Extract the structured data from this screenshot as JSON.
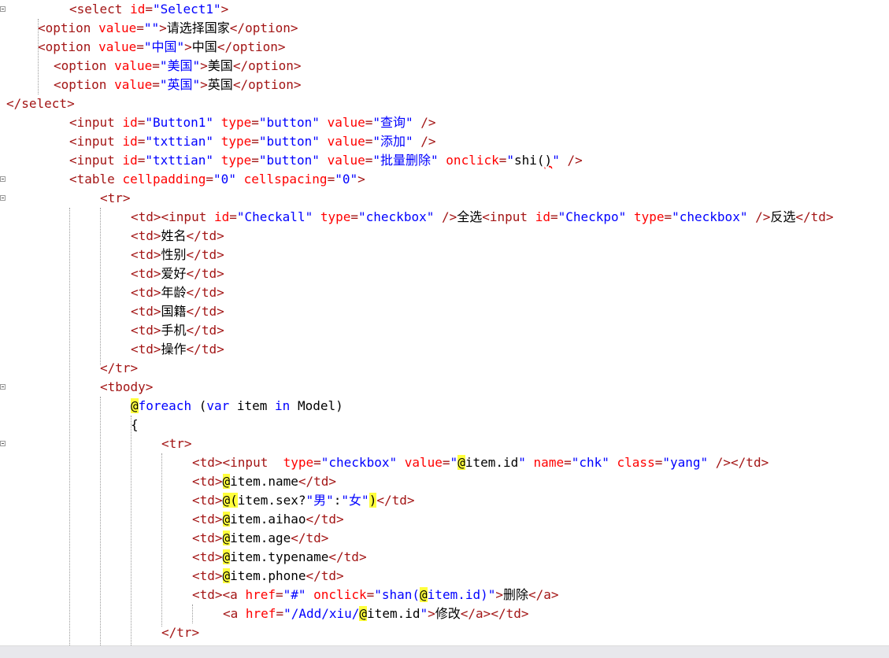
{
  "editor": {
    "lines": [
      {
        "indent": 88,
        "tokens": [
          [
            "tg",
            "<select "
          ],
          [
            "at",
            "id"
          ],
          [
            "tg",
            "="
          ],
          [
            "vl",
            "\"Select1\""
          ],
          [
            "tg",
            ">"
          ]
        ]
      },
      {
        "indent": 48,
        "tokens": [
          [
            "tg",
            "<option "
          ],
          [
            "at",
            "value"
          ],
          [
            "tg",
            "="
          ],
          [
            "vl",
            "\"\""
          ],
          [
            "tg",
            ">"
          ],
          [
            "tx",
            "请选择国家"
          ],
          [
            "tg",
            "</option>"
          ]
        ]
      },
      {
        "indent": 48,
        "tokens": [
          [
            "tg",
            "<option "
          ],
          [
            "at",
            "value"
          ],
          [
            "tg",
            "="
          ],
          [
            "vl",
            "\"中国\""
          ],
          [
            "tg",
            ">"
          ],
          [
            "tx",
            "中国"
          ],
          [
            "tg",
            "</option>"
          ]
        ]
      },
      {
        "indent": 68,
        "tokens": [
          [
            "tg",
            "<option "
          ],
          [
            "at",
            "value"
          ],
          [
            "tg",
            "="
          ],
          [
            "vl",
            "\"美国\""
          ],
          [
            "tg",
            ">"
          ],
          [
            "tx",
            "美国"
          ],
          [
            "tg",
            "</option>"
          ]
        ]
      },
      {
        "indent": 68,
        "tokens": [
          [
            "tg",
            "<option "
          ],
          [
            "at",
            "value"
          ],
          [
            "tg",
            "="
          ],
          [
            "vl",
            "\"英国\""
          ],
          [
            "tg",
            ">"
          ],
          [
            "tx",
            "英国"
          ],
          [
            "tg",
            "</option>"
          ]
        ]
      },
      {
        "indent": 8,
        "tokens": [
          [
            "tg",
            "</select>"
          ]
        ]
      },
      {
        "indent": 88,
        "tokens": [
          [
            "tg",
            "<input "
          ],
          [
            "at",
            "id"
          ],
          [
            "tg",
            "="
          ],
          [
            "vl",
            "\"Button1\""
          ],
          [
            "tg",
            " "
          ],
          [
            "at",
            "type"
          ],
          [
            "tg",
            "="
          ],
          [
            "vl",
            "\"button\""
          ],
          [
            "tg",
            " "
          ],
          [
            "at",
            "value"
          ],
          [
            "tg",
            "="
          ],
          [
            "vl",
            "\"查询\""
          ],
          [
            "tg",
            " />"
          ]
        ]
      },
      {
        "indent": 88,
        "tokens": [
          [
            "tg",
            "<input "
          ],
          [
            "at",
            "id"
          ],
          [
            "tg",
            "="
          ],
          [
            "vl",
            "\"txttian\""
          ],
          [
            "tg",
            " "
          ],
          [
            "at",
            "type"
          ],
          [
            "tg",
            "="
          ],
          [
            "vl",
            "\"button\""
          ],
          [
            "tg",
            " "
          ],
          [
            "at",
            "value"
          ],
          [
            "tg",
            "="
          ],
          [
            "vl",
            "\"添加\""
          ],
          [
            "tg",
            " />"
          ]
        ]
      },
      {
        "indent": 88,
        "tokens": [
          [
            "tg",
            "<input "
          ],
          [
            "at",
            "id"
          ],
          [
            "tg",
            "="
          ],
          [
            "vl",
            "\"txttian\""
          ],
          [
            "tg",
            " "
          ],
          [
            "at",
            "type"
          ],
          [
            "tg",
            "="
          ],
          [
            "vl",
            "\"button\""
          ],
          [
            "tg",
            " "
          ],
          [
            "at",
            "value"
          ],
          [
            "tg",
            "="
          ],
          [
            "vl",
            "\"批量删除\""
          ],
          [
            "tg",
            " "
          ],
          [
            "at",
            "onclick"
          ],
          [
            "tg",
            "="
          ],
          [
            "vl",
            "\""
          ],
          [
            "tx",
            "shi("
          ],
          [
            "squig",
            ")"
          ],
          [
            "vl",
            "\""
          ],
          [
            "tg",
            " />"
          ]
        ]
      },
      {
        "indent": 88,
        "tokens": [
          [
            "tg",
            "<table "
          ],
          [
            "at",
            "cellpadding"
          ],
          [
            "tg",
            "="
          ],
          [
            "vl",
            "\"0\""
          ],
          [
            "tg",
            " "
          ],
          [
            "at",
            "cellspacing"
          ],
          [
            "tg",
            "="
          ],
          [
            "vl",
            "\"0\""
          ],
          [
            "tg",
            ">"
          ]
        ]
      },
      {
        "indent": 127,
        "tokens": [
          [
            "tg",
            "<tr>"
          ]
        ]
      },
      {
        "indent": 166,
        "tokens": [
          [
            "tg",
            "<td><input "
          ],
          [
            "at",
            "id"
          ],
          [
            "tg",
            "="
          ],
          [
            "vl",
            "\"Checkall\""
          ],
          [
            "tg",
            " "
          ],
          [
            "at",
            "type"
          ],
          [
            "tg",
            "="
          ],
          [
            "vl",
            "\"checkbox\""
          ],
          [
            "tg",
            " />"
          ],
          [
            "tx",
            "全选"
          ],
          [
            "tg",
            "<input "
          ],
          [
            "at",
            "id"
          ],
          [
            "tg",
            "="
          ],
          [
            "vl",
            "\"Checkpo\""
          ],
          [
            "tg",
            " "
          ],
          [
            "at",
            "type"
          ],
          [
            "tg",
            "="
          ],
          [
            "vl",
            "\"checkbox\""
          ],
          [
            "tg",
            " />"
          ],
          [
            "tx",
            "反选"
          ],
          [
            "tg",
            "</td>"
          ]
        ]
      },
      {
        "indent": 166,
        "tokens": [
          [
            "tg",
            "<td>"
          ],
          [
            "tx",
            "姓名"
          ],
          [
            "tg",
            "</td>"
          ]
        ]
      },
      {
        "indent": 166,
        "tokens": [
          [
            "tg",
            "<td>"
          ],
          [
            "tx",
            "性别"
          ],
          [
            "tg",
            "</td>"
          ]
        ]
      },
      {
        "indent": 166,
        "tokens": [
          [
            "tg",
            "<td>"
          ],
          [
            "tx",
            "爱好"
          ],
          [
            "tg",
            "</td>"
          ]
        ]
      },
      {
        "indent": 166,
        "tokens": [
          [
            "tg",
            "<td>"
          ],
          [
            "tx",
            "年龄"
          ],
          [
            "tg",
            "</td>"
          ]
        ]
      },
      {
        "indent": 166,
        "tokens": [
          [
            "tg",
            "<td>"
          ],
          [
            "tx",
            "国籍"
          ],
          [
            "tg",
            "</td>"
          ]
        ]
      },
      {
        "indent": 166,
        "tokens": [
          [
            "tg",
            "<td>"
          ],
          [
            "tx",
            "手机"
          ],
          [
            "tg",
            "</td>"
          ]
        ]
      },
      {
        "indent": 166,
        "tokens": [
          [
            "tg",
            "<td>"
          ],
          [
            "tx",
            "操作"
          ],
          [
            "tg",
            "</td>"
          ]
        ]
      },
      {
        "indent": 127,
        "tokens": [
          [
            "tg",
            "</tr>"
          ]
        ]
      },
      {
        "indent": 127,
        "tokens": [
          [
            "tg",
            "<tbody>"
          ]
        ]
      },
      {
        "indent": 166,
        "tokens": [
          [
            "hl",
            "@"
          ],
          [
            "kw",
            "foreach"
          ],
          [
            "tx",
            " ("
          ],
          [
            "kw",
            "var"
          ],
          [
            "tx",
            " item "
          ],
          [
            "kw",
            "in"
          ],
          [
            "tx",
            " Model)"
          ]
        ]
      },
      {
        "indent": 166,
        "tokens": [
          [
            "tx",
            "{"
          ]
        ]
      },
      {
        "indent": 205,
        "tokens": [
          [
            "tg",
            "<tr>"
          ]
        ]
      },
      {
        "indent": 244,
        "tokens": [
          [
            "tg",
            "<td><input  "
          ],
          [
            "at",
            "type"
          ],
          [
            "tg",
            "="
          ],
          [
            "vl",
            "\"checkbox\""
          ],
          [
            "tg",
            " "
          ],
          [
            "at",
            "value"
          ],
          [
            "tg",
            "="
          ],
          [
            "vl",
            "\""
          ],
          [
            "hl",
            "@"
          ],
          [
            "tx",
            "item.id"
          ],
          [
            "vl",
            "\""
          ],
          [
            "tg",
            " "
          ],
          [
            "at",
            "name"
          ],
          [
            "tg",
            "="
          ],
          [
            "vl",
            "\"chk\""
          ],
          [
            "tg",
            " "
          ],
          [
            "at",
            "class"
          ],
          [
            "tg",
            "="
          ],
          [
            "vl",
            "\"yang\""
          ],
          [
            "tg",
            " /></td>"
          ]
        ]
      },
      {
        "indent": 244,
        "tokens": [
          [
            "tg",
            "<td>"
          ],
          [
            "hl",
            "@"
          ],
          [
            "tx",
            "item.name"
          ],
          [
            "tg",
            "</td>"
          ]
        ]
      },
      {
        "indent": 244,
        "tokens": [
          [
            "tg",
            "<td>"
          ],
          [
            "hl",
            "@("
          ],
          [
            "tx",
            "item.sex?"
          ],
          [
            "vl",
            "\"男\""
          ],
          [
            "tx",
            ":"
          ],
          [
            "vl",
            "\"女\""
          ],
          [
            "hl",
            ")"
          ],
          [
            "tg",
            "</td>"
          ]
        ]
      },
      {
        "indent": 244,
        "tokens": [
          [
            "tg",
            "<td>"
          ],
          [
            "hl",
            "@"
          ],
          [
            "tx",
            "item.aihao"
          ],
          [
            "tg",
            "</td>"
          ]
        ]
      },
      {
        "indent": 244,
        "tokens": [
          [
            "tg",
            "<td>"
          ],
          [
            "hl",
            "@"
          ],
          [
            "tx",
            "item.age"
          ],
          [
            "tg",
            "</td>"
          ]
        ]
      },
      {
        "indent": 244,
        "tokens": [
          [
            "tg",
            "<td>"
          ],
          [
            "hl",
            "@"
          ],
          [
            "tx",
            "item.typename"
          ],
          [
            "tg",
            "</td>"
          ]
        ]
      },
      {
        "indent": 244,
        "tokens": [
          [
            "tg",
            "<td>"
          ],
          [
            "hl",
            "@"
          ],
          [
            "tx",
            "item.phone"
          ],
          [
            "tg",
            "</td>"
          ]
        ]
      },
      {
        "indent": 244,
        "tokens": [
          [
            "tg",
            "<td><a "
          ],
          [
            "at",
            "href"
          ],
          [
            "tg",
            "="
          ],
          [
            "vl",
            "\"#\""
          ],
          [
            "tg",
            " "
          ],
          [
            "at",
            "onclick"
          ],
          [
            "tg",
            "="
          ],
          [
            "vl",
            "\"shan("
          ],
          [
            "hl",
            "@"
          ],
          [
            "vl",
            "item.id)\""
          ],
          [
            "tg",
            ">"
          ],
          [
            "tx",
            "删除"
          ],
          [
            "tg",
            "</a>"
          ]
        ]
      },
      {
        "indent": 283,
        "tokens": [
          [
            "tg",
            "<a "
          ],
          [
            "at",
            "href"
          ],
          [
            "tg",
            "="
          ],
          [
            "vl",
            "\"/Add/xiu/"
          ],
          [
            "hl",
            "@"
          ],
          [
            "tx",
            "item.id"
          ],
          [
            "vl",
            "\""
          ],
          [
            "tg",
            ">"
          ],
          [
            "tx",
            "修改"
          ],
          [
            "tg",
            "</a></td>"
          ]
        ]
      },
      {
        "indent": 205,
        "tokens": [
          [
            "tg",
            "</tr>"
          ]
        ]
      },
      {
        "indent": 166,
        "tokens": [
          [
            "tx",
            "}"
          ]
        ]
      }
    ]
  }
}
